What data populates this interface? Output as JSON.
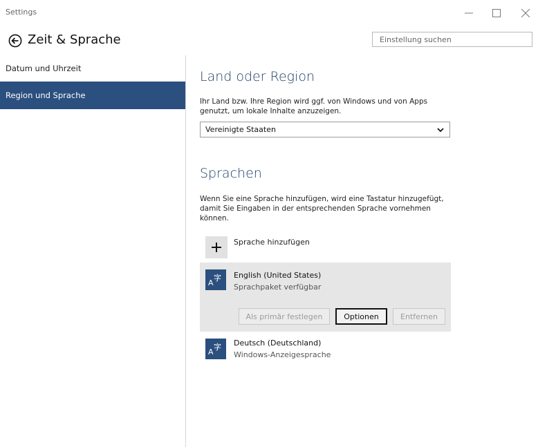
{
  "window": {
    "title": "Settings"
  },
  "header": {
    "page_title": "Zeit & Sprache",
    "search_placeholder": "Einstellung suchen"
  },
  "sidebar": {
    "items": [
      {
        "label": "Datum und Uhrzeit",
        "selected": false
      },
      {
        "label": "Region und Sprache",
        "selected": true
      }
    ]
  },
  "region": {
    "title": "Land oder Region",
    "description": "Ihr Land bzw. Ihre Region wird ggf. von Windows und von Apps genutzt, um lokale Inhalte anzuzeigen.",
    "selected_value": "Vereinigte Staaten"
  },
  "languages": {
    "title": "Sprachen",
    "description": "Wenn Sie eine Sprache hinzufügen, wird eine Tastatur hinzugefügt, damit Sie Eingaben in der entsprechenden Sprache vornehmen können.",
    "add_label": "Sprache hinzufügen",
    "items": [
      {
        "name": "English (United States)",
        "status": "Sprachpaket verfügbar",
        "selected": true
      },
      {
        "name": "Deutsch (Deutschland)",
        "status": "Windows-Anzeigesprache",
        "selected": false
      }
    ],
    "buttons": {
      "set_primary": "Als primär festlegen",
      "options": "Optionen",
      "remove": "Entfernen"
    }
  },
  "colors": {
    "accent": "#2b4f7e",
    "section_title": "#1e3f66",
    "selected_card": "#e6e6e6"
  },
  "icons": {
    "back": "back-arrow-circle-icon",
    "language": "language-glyph-icon",
    "add": "plus-icon",
    "dropdown": "chevron-down-icon"
  }
}
